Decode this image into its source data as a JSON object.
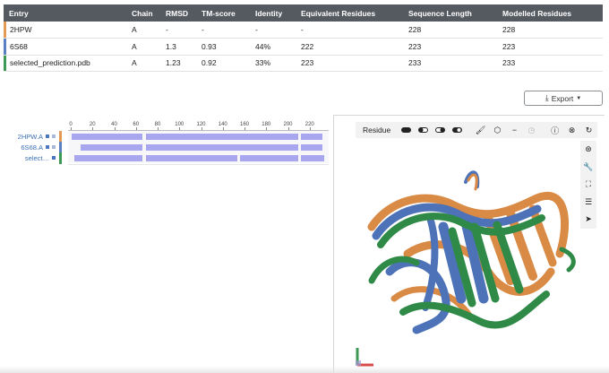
{
  "table": {
    "headers": [
      "Entry",
      "Chain",
      "RMSD",
      "TM-score",
      "Identity",
      "Equivalent Residues",
      "Sequence Length",
      "Modelled Residues"
    ],
    "rows": [
      {
        "entry": "2HPW",
        "chain": "A",
        "rmsd": "-",
        "tm": "-",
        "identity": "-",
        "equiv": "-",
        "seqlen": "228",
        "modelled": "228",
        "color": "#e39a55"
      },
      {
        "entry": "6S68",
        "chain": "A",
        "rmsd": "1.3",
        "tm": "0.93",
        "identity": "44%",
        "equiv": "222",
        "seqlen": "223",
        "modelled": "223",
        "color": "#5b7fc0"
      },
      {
        "entry": "selected_prediction.pdb",
        "chain": "A",
        "rmsd": "1.23",
        "tm": "0.92",
        "identity": "33%",
        "equiv": "223",
        "seqlen": "233",
        "modelled": "233",
        "color": "#3d9a55"
      }
    ]
  },
  "export": {
    "label": "Export",
    "icon": "download-icon"
  },
  "sequence_viewer": {
    "ruler_ticks": [
      "0",
      "20",
      "40",
      "60",
      "80",
      "100",
      "120",
      "140",
      "160",
      "180",
      "200",
      "220"
    ],
    "tracks": [
      {
        "label": "2HPW.A",
        "color": "#e39a55"
      },
      {
        "label": "6S68.A",
        "color": "#5b7fc0"
      },
      {
        "label": "select…",
        "color": "#3d9a55"
      }
    ]
  },
  "viewer": {
    "toolbar_label": "Residue",
    "toolbar_icons": [
      "pill-dark-icon",
      "half-pill-icon",
      "half-pill-alt-icon",
      "pill-contrast-icon",
      "brush-icon",
      "cube-icon",
      "minus-icon",
      "clock-icon",
      "help-icon",
      "close-icon",
      "refresh-icon"
    ],
    "side_icons": [
      "target-icon",
      "wrench-icon",
      "fullscreen-icon",
      "sliders-icon",
      "cursor-icon"
    ],
    "structure_colors": [
      "#d98a45",
      "#4d72b8",
      "#2f8a48"
    ]
  }
}
